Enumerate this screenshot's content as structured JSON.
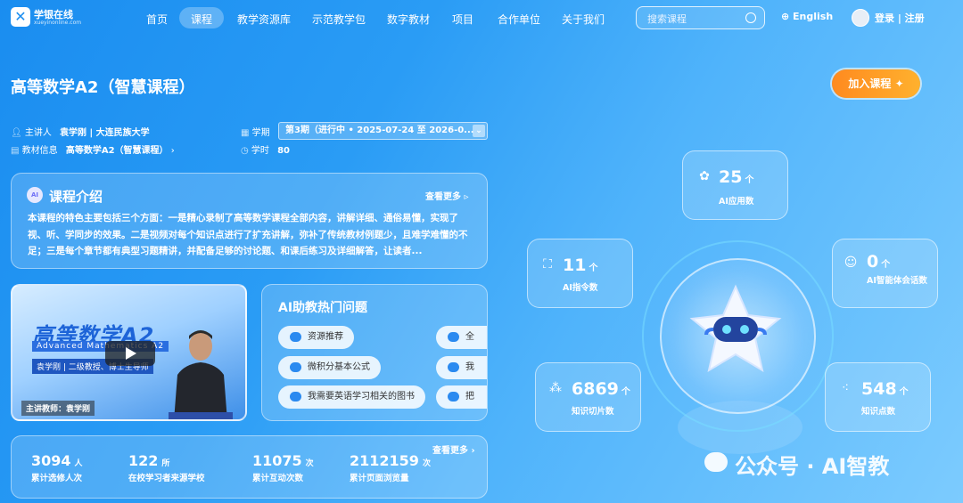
{
  "nav": {
    "logo_text": "学银在线",
    "logo_sub": "xueyinonline.com",
    "items": [
      "首页",
      "课程",
      "教学资源库",
      "示范教学包",
      "数字教材",
      "项目",
      "合作单位",
      "关于我们"
    ],
    "active": "课程",
    "search_placeholder": "搜索课程",
    "language": "English",
    "login": "登录 | 注册"
  },
  "course": {
    "title": "高等数学A2（智慧课程）",
    "join_label": "加入课程",
    "lecturer_label": "主讲人",
    "lecturer_value": "袁学刚 | 大连民族大学",
    "textbook_label": "教材信息",
    "textbook_value": "高等数学A2（智慧课程）",
    "term_label": "学期",
    "term_value": "第3期（进行中 • 2025-07-24 至 2026-0...",
    "hours_label": "学时",
    "hours_value": "80"
  },
  "intro": {
    "badge": "AI",
    "title": "课程介绍",
    "more": "查看更多",
    "text": "本课程的特色主要包括三个方面：一是精心录制了高等数学课程全部内容，讲解详细、通俗易懂，实现了视、听、学同步的效果。二是视频对每个知识点进行了扩充讲解，弥补了传统教材例题少，且难学难懂的不足；三是每个章节都有典型习题精讲，并配备足够的讨论题、和课后练习及详细解答，让读者..."
  },
  "video": {
    "title": "高等数学A2",
    "subtitle": "Advanced Mathematics A2",
    "chip": "袁学刚 | 二级教授、博士生导师",
    "teacher": "主讲教师：袁学刚"
  },
  "faq": {
    "title": "AI助教热门问题",
    "chips": [
      "资源推荐",
      "微积分基本公式",
      "我需要英语学习相关的图书"
    ],
    "chips_right": [
      "全",
      "我",
      "把"
    ]
  },
  "stats": {
    "more": "查看更多",
    "items": [
      {
        "num": "3094",
        "unit": "人",
        "label": "累计选修人次"
      },
      {
        "num": "122",
        "unit": "所",
        "label": "在校学习者来源学校"
      },
      {
        "num": "11075",
        "unit": "次",
        "label": "累计互动次数"
      },
      {
        "num": "2112159",
        "unit": "次",
        "label": "累计页面浏览量"
      }
    ]
  },
  "features": {
    "ai_apps": {
      "num": "25",
      "unit": "个",
      "label": "AI应用数"
    },
    "ai_instructions": {
      "num": "11",
      "unit": "个",
      "label": "AI指令数"
    },
    "ai_agent_sessions": {
      "num": "0",
      "unit": "个",
      "label": "AI智能体会话数"
    },
    "knowledge_slices": {
      "num": "6869",
      "unit": "个",
      "label": "知识切片数"
    },
    "knowledge_points": {
      "num": "548",
      "unit": "个",
      "label": "知识点数"
    }
  },
  "watermark": "公众号 · AI智教",
  "colors": {
    "accent": "#1a8df0",
    "join_button": "#ff9a24"
  }
}
